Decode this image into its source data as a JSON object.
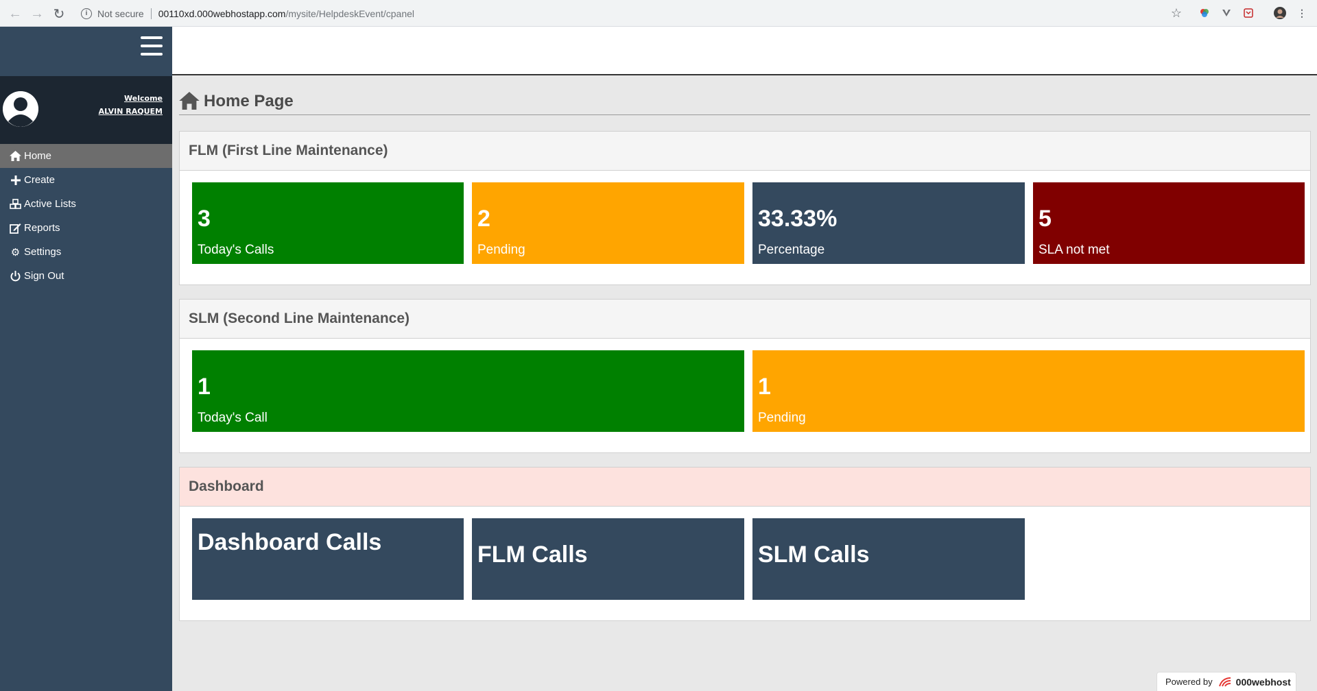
{
  "browser": {
    "security_label": "Not secure",
    "url_host": "00110xd.000webhostapp.com",
    "url_path": "/mysite/HelpdeskEvent/cpanel"
  },
  "sidebar": {
    "welcome": "Welcome",
    "user_name": "ALVIN RAQUEM",
    "items": [
      {
        "label": "Home",
        "icon": "home-icon"
      },
      {
        "label": "Create",
        "icon": "plus-icon"
      },
      {
        "label": "Active Lists",
        "icon": "cubes-icon"
      },
      {
        "label": "Reports",
        "icon": "edit-icon"
      },
      {
        "label": "Settings",
        "icon": "gear-icon"
      },
      {
        "label": "Sign Out",
        "icon": "power-icon"
      }
    ]
  },
  "page": {
    "title": "Home Page"
  },
  "flm": {
    "title": "FLM (First Line Maintenance)",
    "tiles": [
      {
        "value": "3",
        "label": "Today's Calls",
        "color": "#008000"
      },
      {
        "value": "2",
        "label": "Pending",
        "color": "#ffa500"
      },
      {
        "value": "33.33%",
        "label": "Percentage",
        "color": "#34495e"
      },
      {
        "value": "5",
        "label": "SLA not met",
        "color": "#800000"
      }
    ]
  },
  "slm": {
    "title": "SLM (Second Line Maintenance)",
    "tiles": [
      {
        "value": "1",
        "label": "Today's Call",
        "color": "#008000"
      },
      {
        "value": "1",
        "label": "Pending",
        "color": "#ffa500"
      }
    ]
  },
  "dashboard": {
    "title": "Dashboard",
    "tiles": [
      {
        "label": "Dashboard Calls"
      },
      {
        "label": "FLM Calls"
      },
      {
        "label": "SLM Calls"
      }
    ]
  },
  "footer": {
    "powered_by": "Powered by",
    "brand": "000webhost"
  }
}
